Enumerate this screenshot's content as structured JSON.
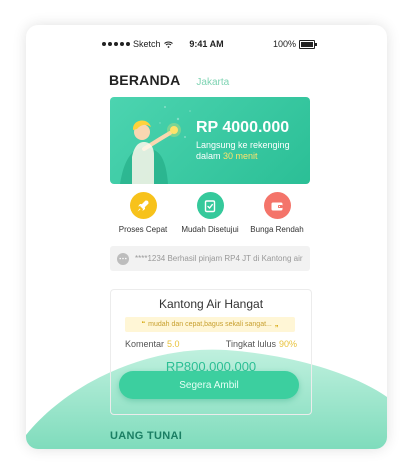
{
  "status_bar": {
    "carrier": "Sketch",
    "time": "9:41 AM",
    "battery": "100%"
  },
  "header": {
    "title": "BERANDA",
    "location": "Jakarta"
  },
  "banner": {
    "amount": "RP 4000.000",
    "subtitle_prefix": "Langsung ke rekenging dalam",
    "subtitle_highlight": "30 menit"
  },
  "features": [
    {
      "label": "Proses Cepat",
      "icon": "rocket-icon",
      "color": "#f7c21b"
    },
    {
      "label": "Mudah Disetujui",
      "icon": "check-clipboard-icon",
      "color": "#35c99b"
    },
    {
      "label": "Bunga Rendah",
      "icon": "wallet-icon",
      "color": "#f4746a"
    }
  ],
  "notice": {
    "text": "****1234 Berhasil pinjam RP4 JT di Kantong air"
  },
  "card": {
    "title": "Kantong Air Hangat",
    "quote": "mudah dan cepat,bagus sekali sangat...",
    "komentar_label": "Komentar",
    "komentar_value": "5.0",
    "tingkat_label": "Tingkat lulus",
    "tingkat_value": "90%",
    "amount": "RP800.000.000"
  },
  "cta": {
    "label": "Segera Ambil"
  },
  "section": {
    "title": "UANG TUNAI"
  },
  "colors": {
    "accent": "#3ccf9f",
    "accent_dark": "#1a7e63",
    "highlight": "#ffe36b"
  }
}
